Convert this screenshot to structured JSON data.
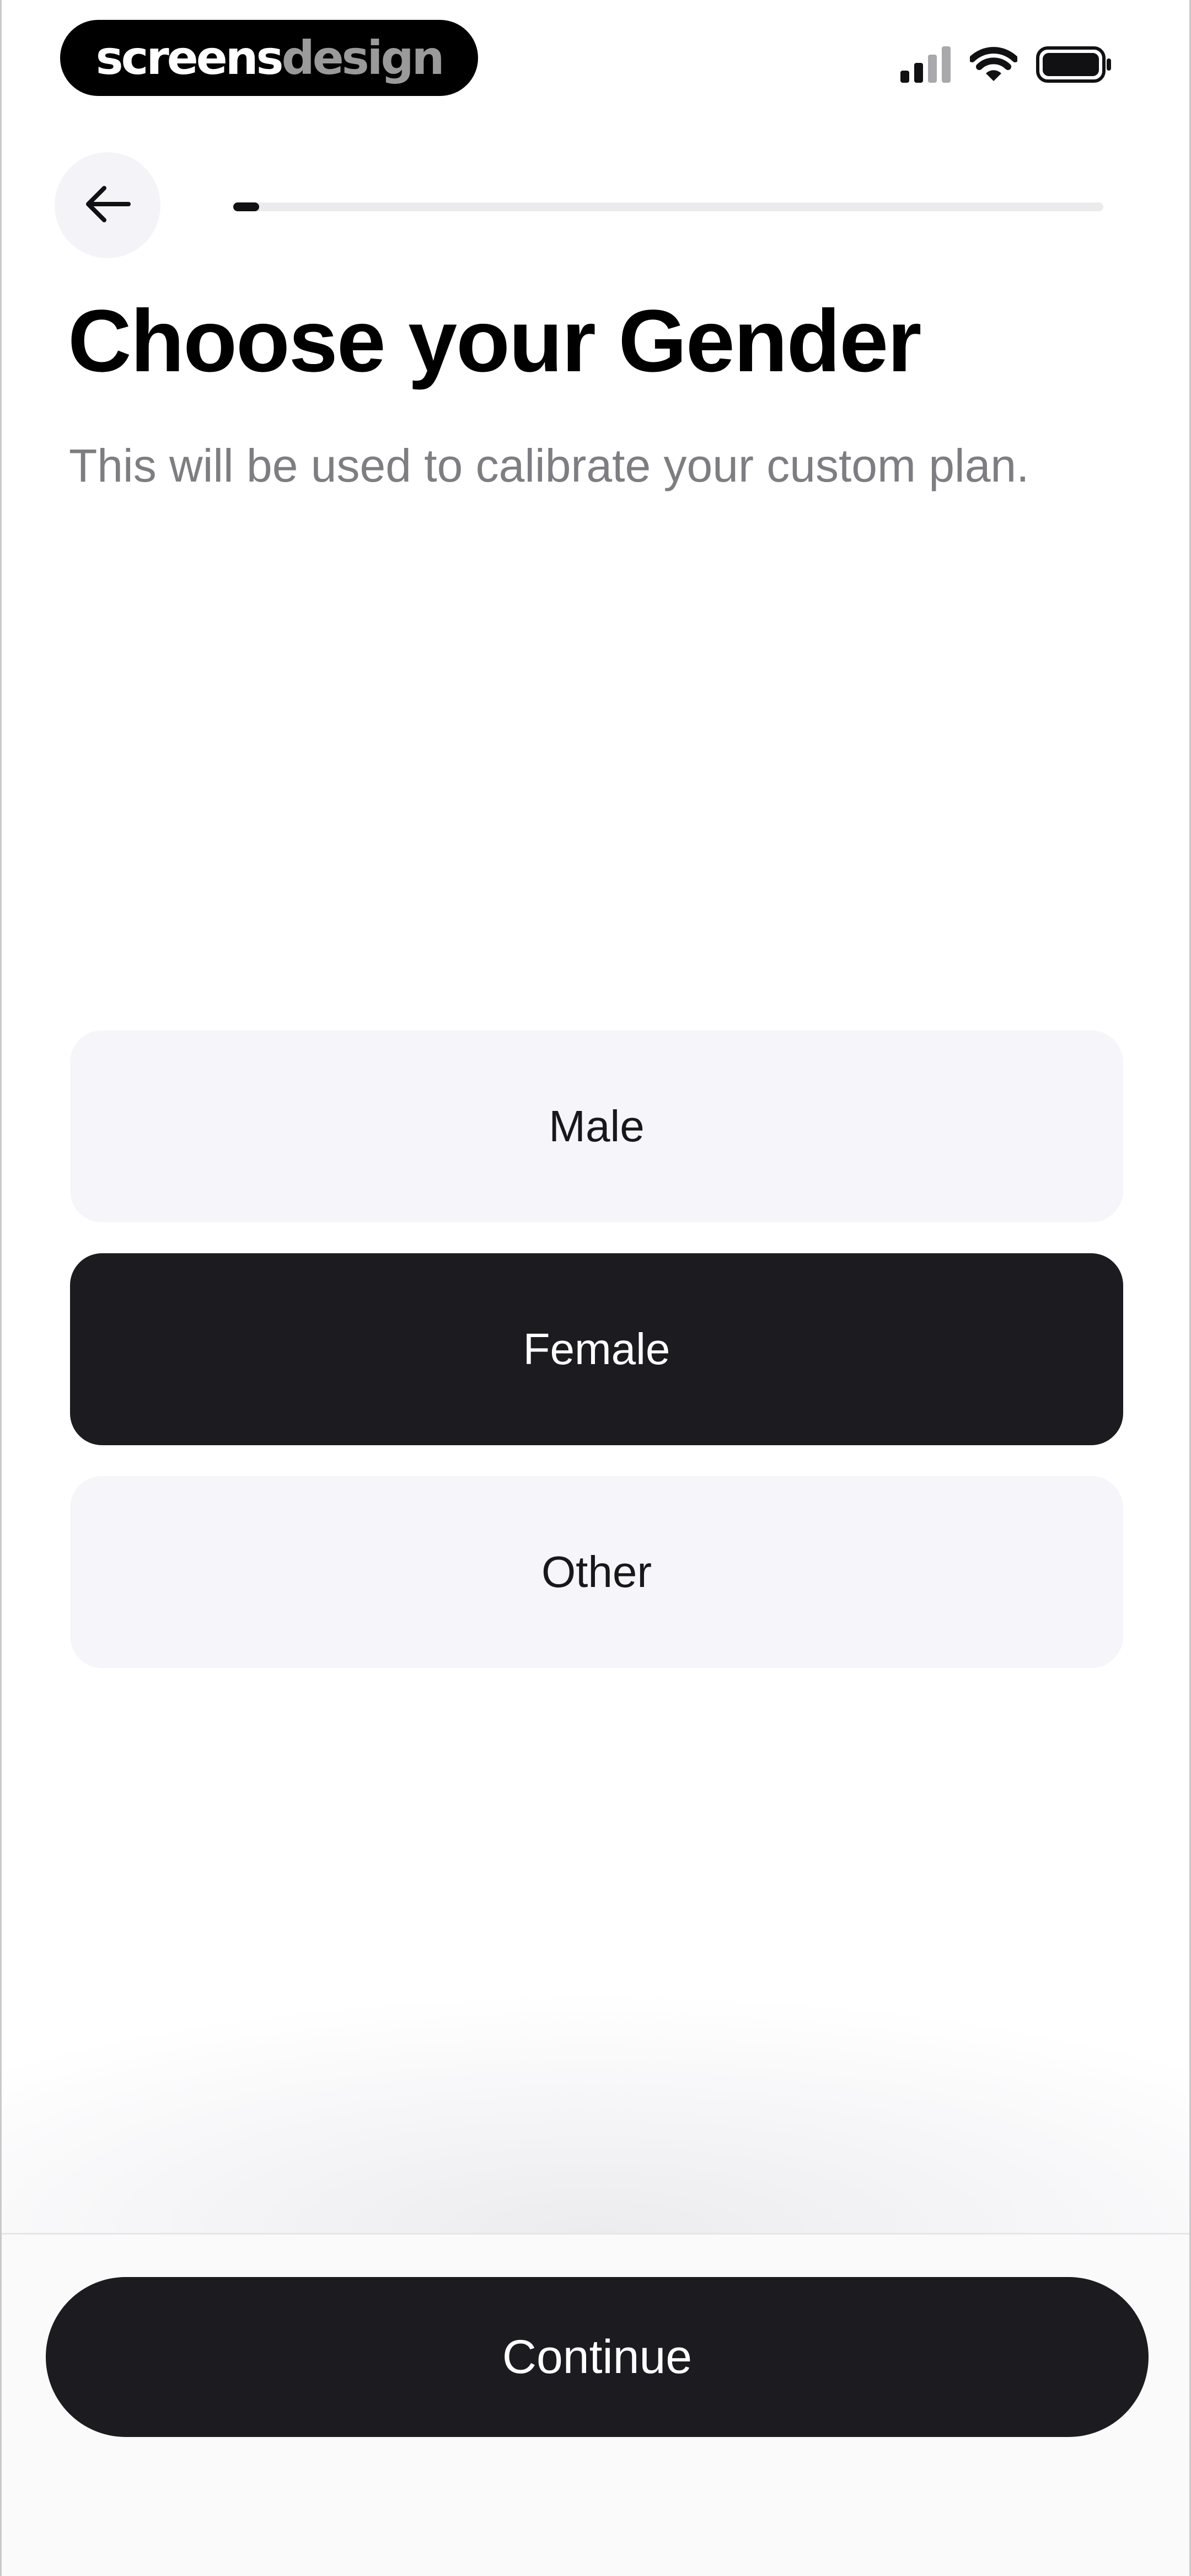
{
  "status_bar": {
    "brand_part1": "screens",
    "brand_part2": "design",
    "icons": [
      "cellular-signal-icon",
      "wifi-icon",
      "battery-icon"
    ]
  },
  "header": {
    "back_icon": "arrow-left-icon",
    "progress": 0.03
  },
  "page": {
    "title": "Choose your Gender",
    "subtitle": "This will be used to calibrate your custom plan."
  },
  "options": [
    {
      "label": "Male",
      "selected": false
    },
    {
      "label": "Female",
      "selected": true
    },
    {
      "label": "Other",
      "selected": false
    }
  ],
  "footer": {
    "continue_label": "Continue"
  },
  "colors": {
    "accent": "#1c1b20",
    "option_bg": "#f5f5fa",
    "subtitle": "#7d7d82"
  }
}
